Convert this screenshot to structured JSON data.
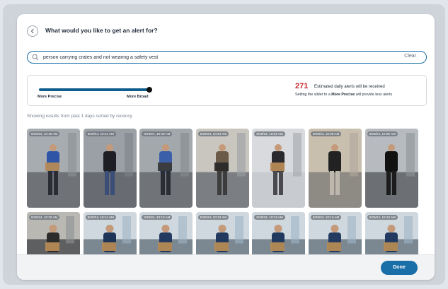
{
  "header": {
    "title": "What would you like to get an alert for?"
  },
  "search": {
    "query": "person carrying crates and not wearing a safety vest",
    "clear_label": "Clear"
  },
  "slider": {
    "left_label": "More Precise",
    "right_label": "More Broad",
    "value": 1.0
  },
  "alerts": {
    "count": "271",
    "count_text": "Estimated daily alerts will be received",
    "hint_prefix": "Setting the slider to a ",
    "hint_emphasis": "More Precise",
    "hint_suffix": " will provide less alerts"
  },
  "results": {
    "info": "Showing results from past 1 days sorted by recency"
  },
  "thumbnails": [
    {
      "timestamp": "8/29/24, 10:45 AM"
    },
    {
      "timestamp": "8/29/24, 10:44 AM"
    },
    {
      "timestamp": "8/29/24, 10:40 AM"
    },
    {
      "timestamp": "8/29/24, 10:34 AM"
    },
    {
      "timestamp": "8/29/24, 10:32 AM"
    },
    {
      "timestamp": "8/29/24, 10:28 AM"
    },
    {
      "timestamp": "8/29/24, 10:25 AM"
    },
    {
      "timestamp": "8/29/24, 10:20 AM"
    },
    {
      "timestamp": "8/29/24, 10:14 AM"
    },
    {
      "timestamp": "8/29/24, 10:13 AM"
    },
    {
      "timestamp": "8/29/24, 10:13 AM"
    },
    {
      "timestamp": "8/29/24, 10:13 AM"
    },
    {
      "timestamp": "8/29/24, 10:13 AM"
    },
    {
      "timestamp": "8/29/24, 10:13 AM"
    }
  ],
  "footer": {
    "done_label": "Done"
  },
  "colors": {
    "accent": "#1a6fa8",
    "alert_count": "#c8282e",
    "track": "#0f5d8f"
  }
}
